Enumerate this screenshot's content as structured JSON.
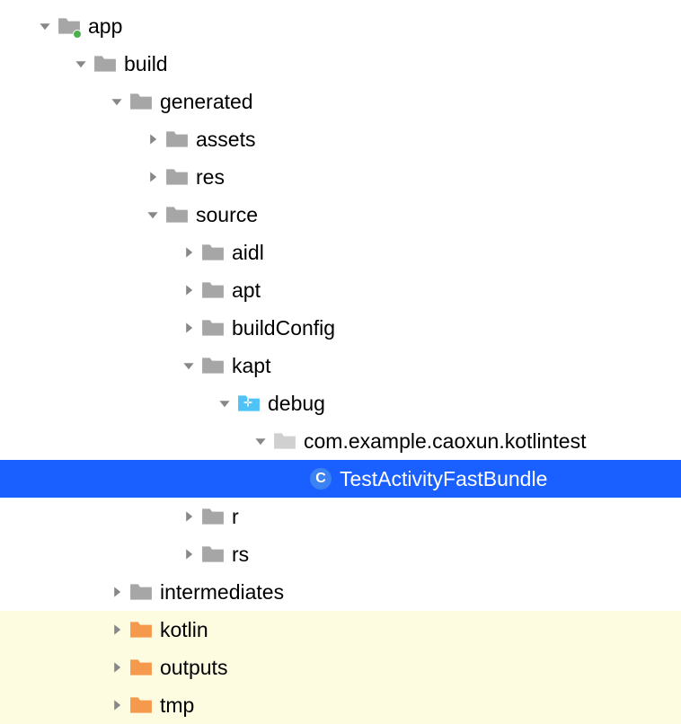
{
  "tree": {
    "app": "app",
    "build": "build",
    "generated": "generated",
    "assets": "assets",
    "res": "res",
    "source": "source",
    "aidl": "aidl",
    "apt": "apt",
    "buildConfig": "buildConfig",
    "kapt": "kapt",
    "debug": "debug",
    "package": "com.example.caoxun.kotlintest",
    "classFile": "TestActivityFastBundle",
    "r": "r",
    "rs": "rs",
    "intermediates": "intermediates",
    "kotlin": "kotlin",
    "outputs": "outputs",
    "tmp": "tmp"
  }
}
